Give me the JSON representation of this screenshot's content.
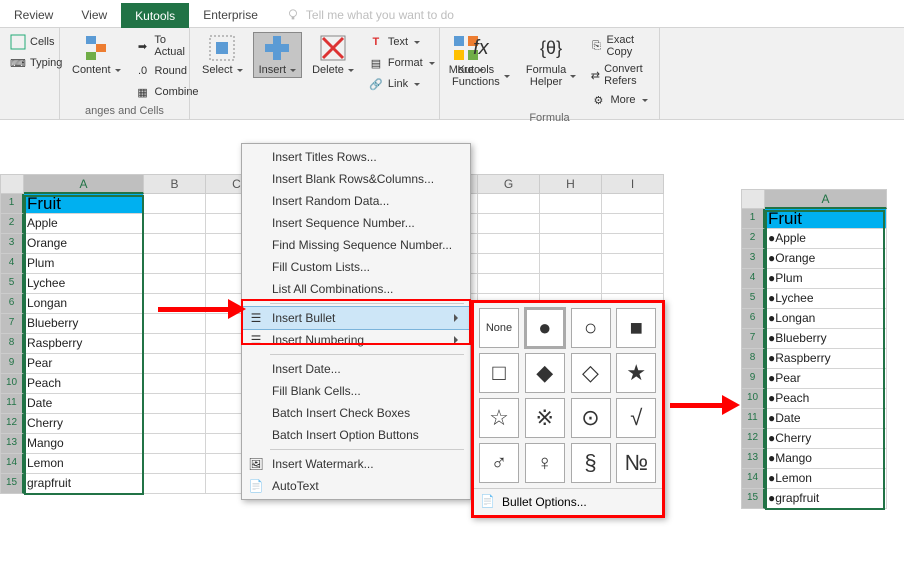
{
  "tabs": {
    "review": "Review",
    "view": "View",
    "kutools": "Kutools",
    "enterprise": "Enterprise",
    "tell": "Tell me what you want to do"
  },
  "ribbon": {
    "cells": "Cells",
    "typing": "Typing",
    "content": "Content",
    "to_actual": "To Actual",
    "round": "Round",
    "combine": "Combine",
    "select": "Select",
    "insert": "Insert",
    "delete": "Delete",
    "text": "Text",
    "format": "Format",
    "link": "Link",
    "more": "More",
    "kfuncs": "Kutools Functions",
    "fhelper": "Formula Helper",
    "exact": "Exact Copy",
    "convert": "Convert Refers",
    "moreBtn": "More",
    "group_ranges": "anges and Cells",
    "group_formula": "Formula"
  },
  "menu": {
    "titles_rows": "Insert Titles Rows...",
    "blank_rows": "Insert Blank Rows&Columns...",
    "random": "Insert Random Data...",
    "sequence": "Insert Sequence Number...",
    "missing": "Find Missing Sequence Number...",
    "custom": "Fill Custom Lists...",
    "combos": "List All Combinations...",
    "bullet": "Insert Bullet",
    "numbering": "Insert Numbering",
    "date": "Insert Date...",
    "fillblank": "Fill Blank Cells...",
    "checkboxes": "Batch Insert Check Boxes",
    "options": "Batch Insert Option Buttons",
    "watermark": "Insert Watermark...",
    "autotext": "AutoText"
  },
  "bullets": {
    "none": "None",
    "b1": "●",
    "b2": "○",
    "b3": "■",
    "b4": "□",
    "b5": "◆",
    "b6": "◇",
    "b7": "★",
    "b8": "☆",
    "b9": "※",
    "b10": "⊙",
    "b11": "√",
    "b12": "♂",
    "b13": "♀",
    "b14": "§",
    "b15": "№",
    "opts": "Bullet Options..."
  },
  "columns": {
    "A": "A",
    "B": "B",
    "C": "C",
    "G": "G",
    "H": "H",
    "I": "I"
  },
  "header_cell": "Fruit",
  "fruits": [
    "Apple",
    "Orange",
    "Plum",
    "Lychee",
    "Longan",
    "Blueberry",
    "Raspberry",
    "Pear",
    "Peach",
    "Date",
    "Cherry",
    "Mango",
    "Lemon",
    "grapfruit"
  ],
  "bullet_char": "●",
  "result_fruits": [
    "●Apple",
    "●Orange",
    "●Plum",
    "●Lychee",
    "●Longan",
    "●Blueberry",
    "●Raspberry",
    "●Pear",
    "●Peach",
    "●Date",
    "●Cherry",
    "●Mango",
    "●Lemon",
    "●grapfruit"
  ]
}
